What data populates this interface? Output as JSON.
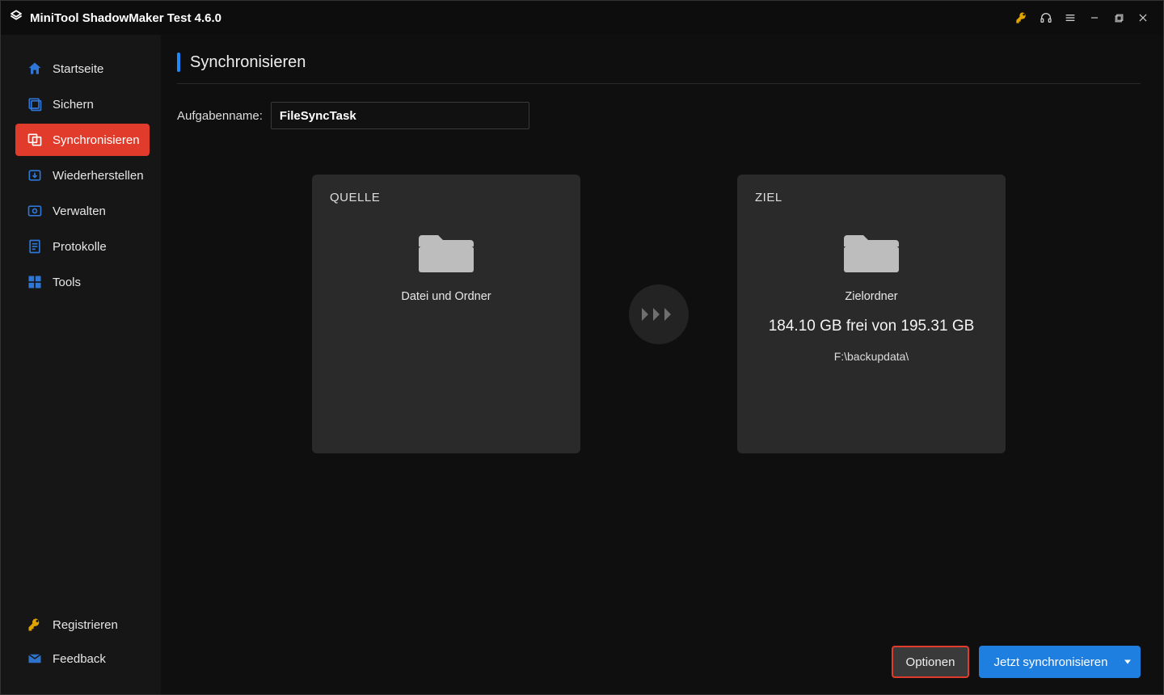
{
  "app": {
    "title": "MiniTool ShadowMaker Test 4.6.0"
  },
  "sidebar": {
    "items": [
      {
        "label": "Startseite"
      },
      {
        "label": "Sichern"
      },
      {
        "label": "Synchronisieren"
      },
      {
        "label": "Wiederherstellen"
      },
      {
        "label": "Verwalten"
      },
      {
        "label": "Protokolle"
      },
      {
        "label": "Tools"
      }
    ],
    "footer": {
      "register": "Registrieren",
      "feedback": "Feedback"
    }
  },
  "page": {
    "title": "Synchronisieren",
    "task_label": "Aufgabenname:",
    "task_value": "FileSyncTask",
    "source": {
      "title": "QUELLE",
      "line1": "Datei und Ordner"
    },
    "target": {
      "title": "ZIEL",
      "line1": "Zielordner",
      "line2": "184.10 GB frei von 195.31 GB",
      "line3": "F:\\backupdata\\"
    },
    "options_label": "Optionen",
    "sync_now_label": "Jetzt synchronisieren"
  }
}
